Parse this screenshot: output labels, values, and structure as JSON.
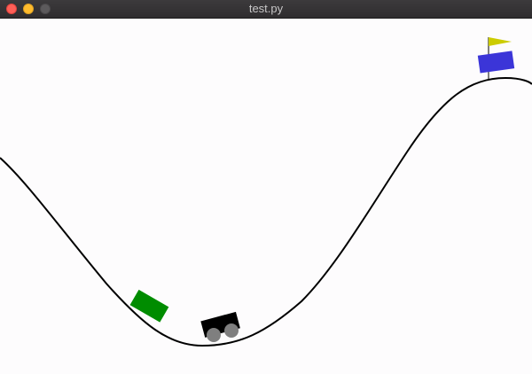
{
  "window": {
    "title": "test.py"
  },
  "colors": {
    "background": "#fdfcfd",
    "track": "#000000",
    "cart": "#000000",
    "wheel": "#7f7f7f",
    "green_car": "#008c00",
    "blue_car": "#3b35d8",
    "flag": "#cccc00",
    "flagpole": "#000000"
  },
  "icons": [
    "close-button",
    "minimize-button",
    "maximize-button",
    "flag-icon"
  ]
}
